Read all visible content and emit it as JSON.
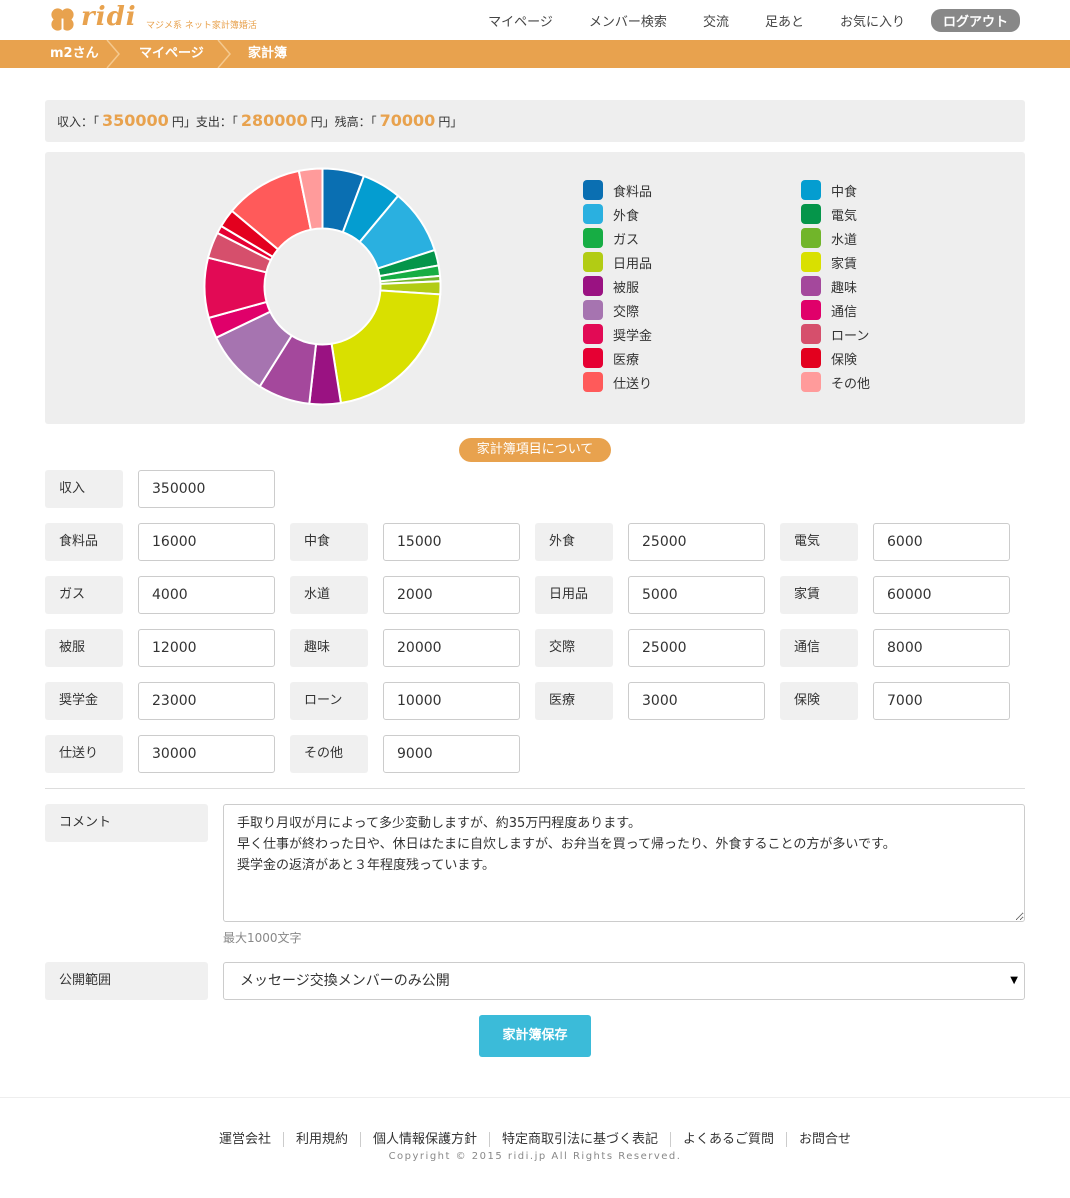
{
  "header": {
    "brand": "ridi",
    "tagline": "マジメ系 ネット家計簿婚活",
    "nav": [
      "マイページ",
      "メンバー検索",
      "交流",
      "足あと",
      "お気に入り"
    ],
    "logout": "ログアウト"
  },
  "breadcrumb": [
    "m2さん",
    "マイページ",
    "家計簿"
  ],
  "summary": {
    "income_prefix": "収入：「",
    "income": "350000",
    "expense_prefix": "円」支出：「",
    "expense": "280000",
    "balance_prefix": "円」残高：「",
    "balance": "70000",
    "suffix": "円」"
  },
  "chart_data": {
    "type": "pie",
    "categories": [
      "食料品",
      "中食",
      "外食",
      "電気",
      "ガス",
      "水道",
      "日用品",
      "家賃",
      "被服",
      "趣味",
      "交際",
      "通信",
      "奨学金",
      "ローン",
      "医療",
      "保険",
      "仕送り",
      "その他"
    ],
    "values": [
      16000,
      15000,
      25000,
      6000,
      4000,
      2000,
      5000,
      60000,
      12000,
      20000,
      25000,
      8000,
      23000,
      10000,
      3000,
      7000,
      30000,
      9000
    ],
    "colors": [
      "#0a6fb2",
      "#049dd0",
      "#2ab0e0",
      "#05954a",
      "#17ad44",
      "#71b52a",
      "#b2cc14",
      "#d9e000",
      "#9a1282",
      "#a4489c",
      "#a674b0",
      "#e0006a",
      "#e20a55",
      "#d64f6c",
      "#e60033",
      "#e3001e",
      "#ff5a5a",
      "#ff9b9b"
    ],
    "legend_position": "right"
  },
  "about_button": "家計簿項目について",
  "form": {
    "income": {
      "label": "収入",
      "value": "350000"
    },
    "items": [
      {
        "label": "食料品",
        "value": "16000"
      },
      {
        "label": "中食",
        "value": "15000"
      },
      {
        "label": "外食",
        "value": "25000"
      },
      {
        "label": "電気",
        "value": "6000"
      },
      {
        "label": "ガス",
        "value": "4000"
      },
      {
        "label": "水道",
        "value": "2000"
      },
      {
        "label": "日用品",
        "value": "5000"
      },
      {
        "label": "家賃",
        "value": "60000"
      },
      {
        "label": "被服",
        "value": "12000"
      },
      {
        "label": "趣味",
        "value": "20000"
      },
      {
        "label": "交際",
        "value": "25000"
      },
      {
        "label": "通信",
        "value": "8000"
      },
      {
        "label": "奨学金",
        "value": "23000"
      },
      {
        "label": "ローン",
        "value": "10000"
      },
      {
        "label": "医療",
        "value": "3000"
      },
      {
        "label": "保険",
        "value": "7000"
      },
      {
        "label": "仕送り",
        "value": "30000"
      },
      {
        "label": "その他",
        "value": "9000"
      }
    ],
    "comment_label": "コメント",
    "comment_lines": [
      "手取り月収が月によって多少変動しますが、約35万円程度あります。",
      "早く仕事が終わった日や、休日はたまに自炊しますが、お弁当を買って帰ったり、外食することの方が多いです。",
      "奨学金の返済があと３年程度残っています。"
    ],
    "comment_max": "最大1000文字",
    "scope_label": "公開範囲",
    "scope_value": "メッセージ交換メンバーのみ公開",
    "save": "家計簿保存"
  },
  "footer": {
    "links": [
      "運営会社",
      "利用規約",
      "個人情報保護方針",
      "特定商取引法に基づく表記",
      "よくあるご質問",
      "お問合せ"
    ],
    "copyright": "Copyright © 2015 ridi.jp All Rights Reserved."
  }
}
